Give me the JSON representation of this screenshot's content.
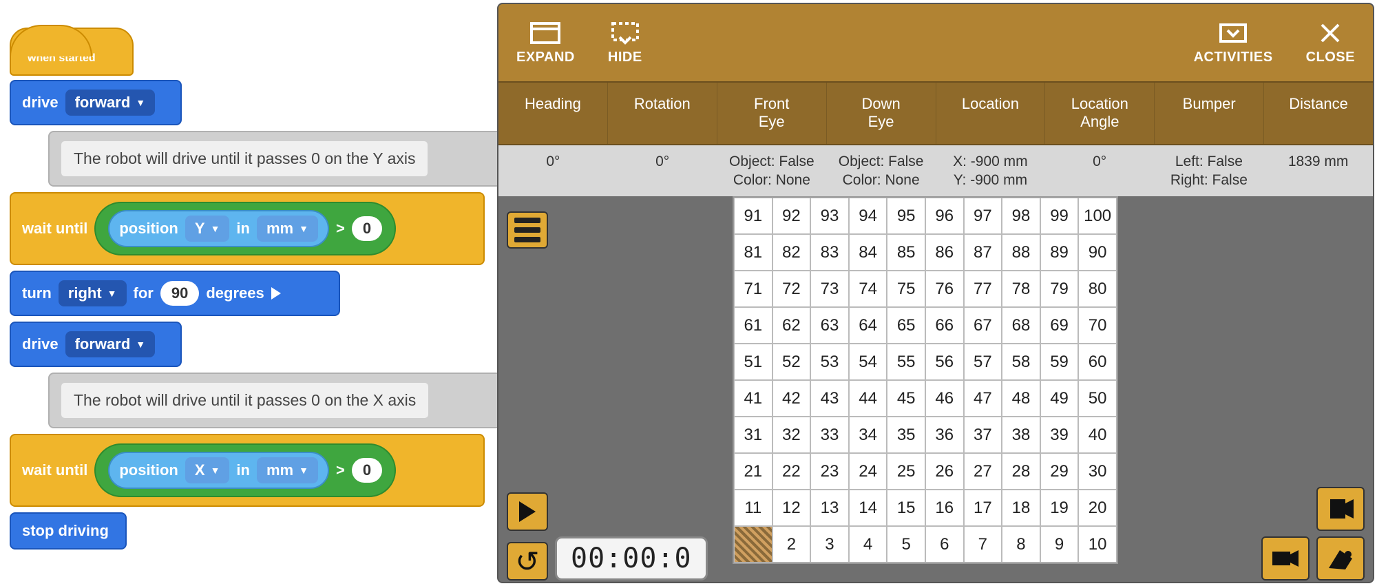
{
  "blocks": {
    "hat_label": "when started",
    "drive_label": "drive",
    "forward_label": "forward",
    "comment_y": "The robot will drive until it passes 0 on the Y axis",
    "comment_x": "The robot will drive until it passes 0 on the X axis",
    "wait_until_label": "wait until",
    "position_label": "position",
    "axis_y": "Y",
    "axis_x": "X",
    "in_label": "in",
    "unit_label": "mm",
    "gt_label": ">",
    "zero_label": "0",
    "turn_label": "turn",
    "right_label": "right",
    "for_label": "for",
    "degrees_label": "degrees",
    "degrees_value": "90",
    "stop_label": "stop driving"
  },
  "toolbar": {
    "expand": "EXPAND",
    "hide": "HIDE",
    "activities": "ACTIVITIES",
    "close": "CLOSE"
  },
  "sensors": {
    "headers": {
      "heading": "Heading",
      "rotation": "Rotation",
      "front_eye": "Front Eye",
      "down_eye": "Down Eye",
      "location": "Location",
      "location_angle": "Location Angle",
      "bumper": "Bumper",
      "distance": "Distance"
    },
    "values": {
      "heading": "0°",
      "rotation": "0°",
      "front_eye_l1": "Object: False",
      "front_eye_l2": "Color: None",
      "down_eye_l1": "Object: False",
      "down_eye_l2": "Color: None",
      "location_l1": "X: -900 mm",
      "location_l2": "Y: -900 mm",
      "location_angle": "0°",
      "bumper_l1": "Left: False",
      "bumper_l2": "Right: False",
      "distance": "1839 mm"
    }
  },
  "timer": "00:00:0",
  "grid": {
    "rows": [
      [
        91,
        92,
        93,
        94,
        95,
        96,
        97,
        98,
        99,
        100
      ],
      [
        81,
        82,
        83,
        84,
        85,
        86,
        87,
        88,
        89,
        90
      ],
      [
        71,
        72,
        73,
        74,
        75,
        76,
        77,
        78,
        79,
        80
      ],
      [
        61,
        62,
        63,
        64,
        65,
        66,
        67,
        68,
        69,
        70
      ],
      [
        51,
        52,
        53,
        54,
        55,
        56,
        57,
        58,
        59,
        60
      ],
      [
        41,
        42,
        43,
        44,
        45,
        46,
        47,
        48,
        49,
        50
      ],
      [
        31,
        32,
        33,
        34,
        35,
        36,
        37,
        38,
        39,
        40
      ],
      [
        21,
        22,
        23,
        24,
        25,
        26,
        27,
        28,
        29,
        30
      ],
      [
        11,
        12,
        13,
        14,
        15,
        16,
        17,
        18,
        19,
        20
      ],
      [
        "robot",
        2,
        3,
        4,
        5,
        6,
        7,
        8,
        9,
        10
      ]
    ]
  }
}
